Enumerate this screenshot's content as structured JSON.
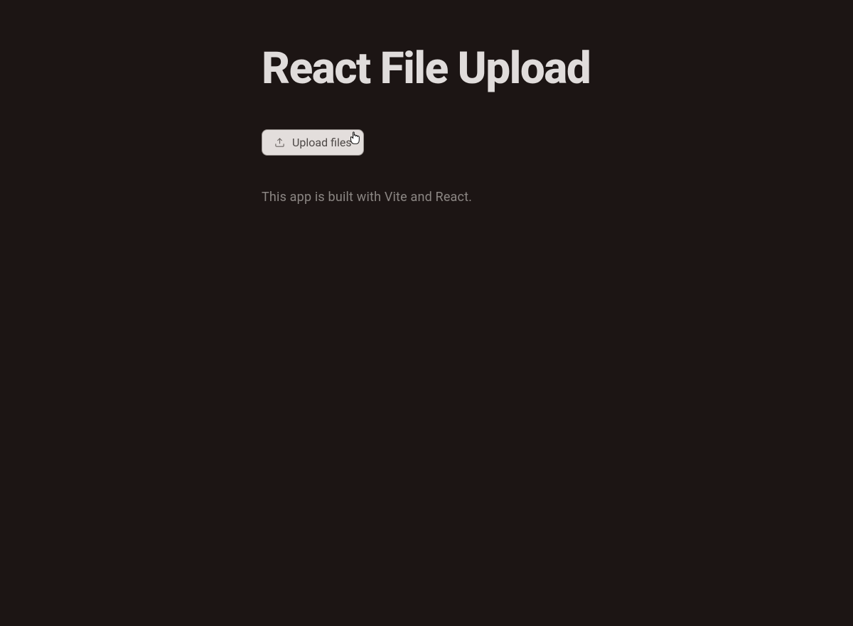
{
  "header": {
    "title": "React File Upload"
  },
  "actions": {
    "upload_label": "Upload files"
  },
  "main": {
    "description": "This app is built with Vite and React."
  }
}
